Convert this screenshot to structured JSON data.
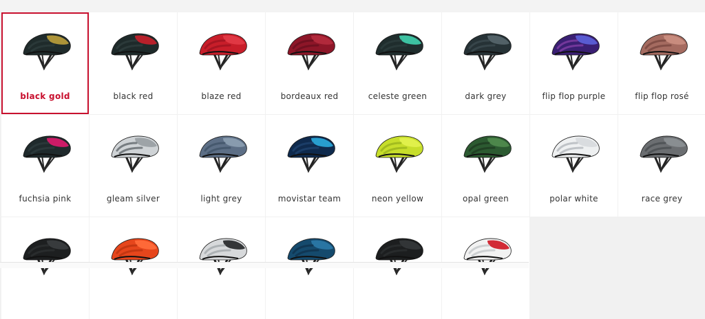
{
  "variants": [
    {
      "label": "black gold",
      "selected": true,
      "shell": "#1f2b2b",
      "accent": "#b59a3a",
      "stripe": "#2b3a3a"
    },
    {
      "label": "black red",
      "selected": false,
      "shell": "#1e2a2a",
      "accent": "#c0202a",
      "stripe": "#2c3b3b"
    },
    {
      "label": "blaze red",
      "selected": false,
      "shell": "#c81e2a",
      "accent": "#e23a46",
      "stripe": "#a31421"
    },
    {
      "label": "bordeaux red",
      "selected": false,
      "shell": "#8d1628",
      "accent": "#b32a3c",
      "stripe": "#6d0f1f"
    },
    {
      "label": "celeste green",
      "selected": false,
      "shell": "#1f2d2d",
      "accent": "#3fc9a8",
      "stripe": "#2a3b3b"
    },
    {
      "label": "dark grey",
      "selected": false,
      "shell": "#263236",
      "accent": "#54646a",
      "stripe": "#3a474c"
    },
    {
      "label": "flip flop purple",
      "selected": false,
      "shell": "#3a1f73",
      "accent": "#5b5fd6",
      "stripe": "#7a3aa0"
    },
    {
      "label": "flip flop rosé",
      "selected": false,
      "shell": "#a56b60",
      "accent": "#c98e7f",
      "stripe": "#7e4b44"
    },
    {
      "label": "fuchsia pink",
      "selected": false,
      "shell": "#1f2a2c",
      "accent": "#d61a6a",
      "stripe": "#2b393b"
    },
    {
      "label": "gleam silver",
      "selected": false,
      "shell": "#cfd3d6",
      "accent": "#9aa0a4",
      "stripe": "#6d7378"
    },
    {
      "label": "light grey",
      "selected": false,
      "shell": "#5d6f86",
      "accent": "#8a9db0",
      "stripe": "#44566b"
    },
    {
      "label": "movistar team",
      "selected": false,
      "shell": "#0f2a4d",
      "accent": "#2aa4d6",
      "stripe": "#1d3f6a"
    },
    {
      "label": "neon yellow",
      "selected": false,
      "shell": "#c7de2b",
      "accent": "#e2f04d",
      "stripe": "#9fb81e"
    },
    {
      "label": "opal green",
      "selected": false,
      "shell": "#2c5a31",
      "accent": "#4f8a4d",
      "stripe": "#203e24"
    },
    {
      "label": "polar white",
      "selected": false,
      "shell": "#eef0f1",
      "accent": "#d7dadd",
      "stripe": "#b9bec2"
    },
    {
      "label": "race grey",
      "selected": false,
      "shell": "#6b6e71",
      "accent": "#8b8f92",
      "stripe": "#4e5154"
    },
    {
      "label": "",
      "selected": false,
      "shell": "#1d1f20",
      "accent": "#3a3d3f",
      "stripe": "#2b2d2f"
    },
    {
      "label": "",
      "selected": false,
      "shell": "#e6461c",
      "accent": "#ff6b3a",
      "stripe": "#c13512"
    },
    {
      "label": "",
      "selected": false,
      "shell": "#d7d9db",
      "accent": "#2b2d2f",
      "stripe": "#a9adb0"
    },
    {
      "label": "",
      "selected": false,
      "shell": "#154a6d",
      "accent": "#2a77a6",
      "stripe": "#0f3551"
    },
    {
      "label": "",
      "selected": false,
      "shell": "#1c1e1f",
      "accent": "#343739",
      "stripe": "#2a2c2d"
    },
    {
      "label": "",
      "selected": false,
      "shell": "#f2f2f2",
      "accent": "#d01f2b",
      "stripe": "#c9ccce"
    }
  ]
}
